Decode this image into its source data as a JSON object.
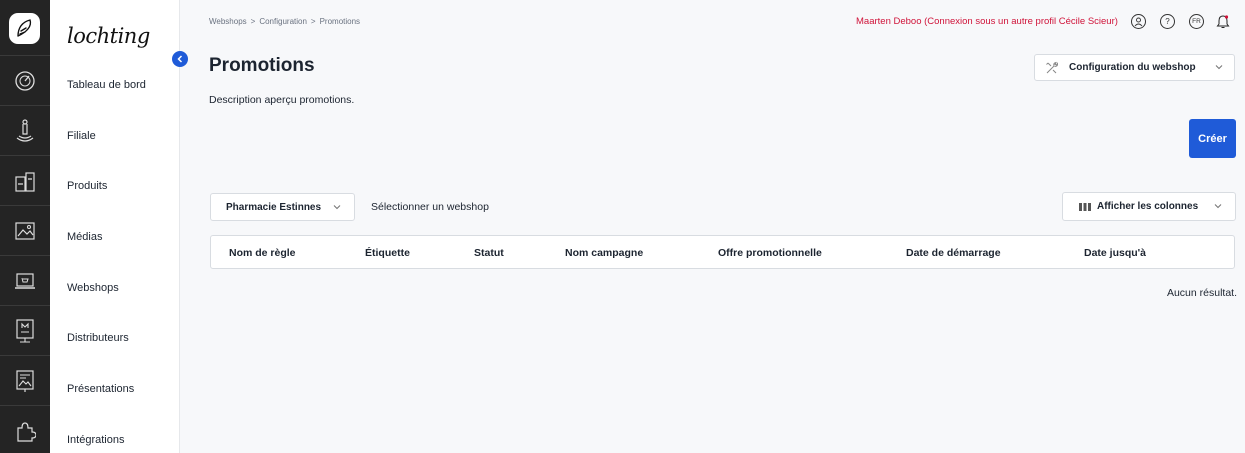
{
  "rail": {
    "icons": [
      "dashboard-icon",
      "store-icon",
      "products-icon",
      "media-icon",
      "webshop-icon",
      "distributors-icon",
      "presentations-icon",
      "integrations-icon"
    ]
  },
  "sidebar": {
    "brand": "lochting",
    "items": [
      {
        "label": "Tableau de bord"
      },
      {
        "label": "Filiale"
      },
      {
        "label": "Produits"
      },
      {
        "label": "Médias"
      },
      {
        "label": "Webshops"
      },
      {
        "label": "Distributeurs"
      },
      {
        "label": "Présentations"
      },
      {
        "label": "Intégrations"
      }
    ]
  },
  "breadcrumb": [
    "Webshops",
    "Configuration",
    "Promotions"
  ],
  "breadcrumb_separator": ">",
  "user_info": "Maarten Deboo (Connexion sous un autre profil Cécile Scieur)",
  "language": "FR",
  "help": "?",
  "page": {
    "title": "Promotions",
    "description": "Description aperçu promotions."
  },
  "toolbar": {
    "config_label": "Configuration du webshop",
    "create_label": "Créer"
  },
  "filters": {
    "shop_value": "Pharmacie Estinnes",
    "shop_hint": "Sélectionner un webshop",
    "columns_label": "Afficher les colonnes"
  },
  "table": {
    "columns": [
      "Nom de règle",
      "Étiquette",
      "Statut",
      "Nom campagne",
      "Offre promotionnelle",
      "Date de démarrage",
      "Date jusqu'à"
    ],
    "empty_text": "Aucun résultat."
  },
  "colors": {
    "accent": "#1f5bd8",
    "user_text": "#d0143a",
    "rail_bg": "#242424"
  }
}
